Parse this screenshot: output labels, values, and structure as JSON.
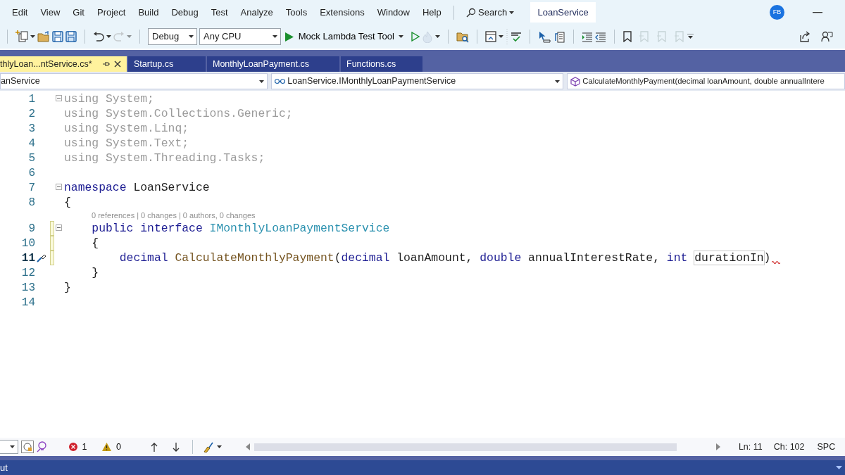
{
  "menu": [
    "Edit",
    "View",
    "Git",
    "Project",
    "Build",
    "Debug",
    "Test",
    "Analyze",
    "Tools",
    "Extensions",
    "Window",
    "Help"
  ],
  "search": {
    "label": "Search"
  },
  "solution_name": "LoanService",
  "avatar": "FB",
  "toolbar": {
    "configuration": "Debug",
    "platform": "Any CPU",
    "run_target": "Mock Lambda Test Tool"
  },
  "tabs": [
    {
      "label": "thlyLoan...ntService.cs*",
      "selected": true
    },
    {
      "label": "Startup.cs",
      "selected": false
    },
    {
      "label": "MonthlyLoanPayment.cs",
      "selected": false
    },
    {
      "label": "Functions.cs",
      "selected": false
    }
  ],
  "nav_bar": {
    "project": "anService",
    "type": "LoanService.IMonthlyLoanPaymentService",
    "member": "CalculateMonthlyPayment(decimal loanAmount, double annualIntere"
  },
  "editor": {
    "lines": [
      {
        "number": "1",
        "collapsible": true,
        "tokens": [
          {
            "kind": "dim",
            "text": "using System;"
          }
        ]
      },
      {
        "number": "2",
        "tokens": [
          {
            "kind": "dim",
            "text": "using System.Collections.Generic;"
          }
        ]
      },
      {
        "number": "3",
        "tokens": [
          {
            "kind": "dim",
            "text": "using System.Linq;"
          }
        ]
      },
      {
        "number": "4",
        "tokens": [
          {
            "kind": "dim",
            "text": "using System.Text;"
          }
        ]
      },
      {
        "number": "5",
        "tokens": [
          {
            "kind": "dim",
            "text": "using System.Threading.Tasks;"
          }
        ]
      },
      {
        "number": "6"
      },
      {
        "number": "7",
        "collapsible": true,
        "tokens": [
          {
            "kind": "kw",
            "text": "namespace"
          },
          {
            "kind": "plain",
            "text": " LoanService"
          }
        ]
      },
      {
        "number": "8",
        "tokens": [
          {
            "kind": "plain",
            "text": "{"
          }
        ]
      },
      {
        "number": "9",
        "collapsible": true,
        "changed": true,
        "code_lens": "0 references | 0 changes | 0 authors, 0 changes",
        "tokens": [
          {
            "kind": "kw",
            "text": "    public"
          },
          {
            "kind": "kw",
            "text": " interface"
          },
          {
            "kind": "type",
            "text": " IMonthlyLoanPaymentService"
          }
        ]
      },
      {
        "number": "10",
        "changed": true,
        "tokens": [
          {
            "kind": "plain",
            "text": "    {"
          }
        ]
      },
      {
        "number": "11",
        "changed": true,
        "current": true,
        "quick_actions": true,
        "tokens": [
          {
            "kind": "kw",
            "text": "        decimal"
          },
          {
            "kind": "method",
            "text": " CalculateMonthlyPayment"
          },
          {
            "kind": "plain",
            "text": "("
          },
          {
            "kind": "kw",
            "text": "decimal"
          },
          {
            "kind": "plain",
            "text": " loanAmount,"
          },
          {
            "kind": "kw",
            "text": " double"
          },
          {
            "kind": "plain",
            "text": " annualInterestRate,"
          },
          {
            "kind": "kw",
            "text": " int"
          },
          {
            "kind": "highlight",
            "text": " durationIn"
          },
          {
            "kind": "plain",
            "text": ")"
          },
          {
            "kind": "squiggle"
          }
        ]
      },
      {
        "number": "12",
        "tokens": [
          {
            "kind": "plain",
            "text": "    }"
          }
        ]
      },
      {
        "number": "13",
        "tokens": [
          {
            "kind": "plain",
            "text": "}"
          }
        ]
      },
      {
        "number": "14"
      }
    ]
  },
  "status": {
    "errors": "1",
    "warnings": "0",
    "line": "Ln: 11",
    "column": "Ch: 102",
    "mode": "SPC"
  },
  "output_tab": "ut"
}
